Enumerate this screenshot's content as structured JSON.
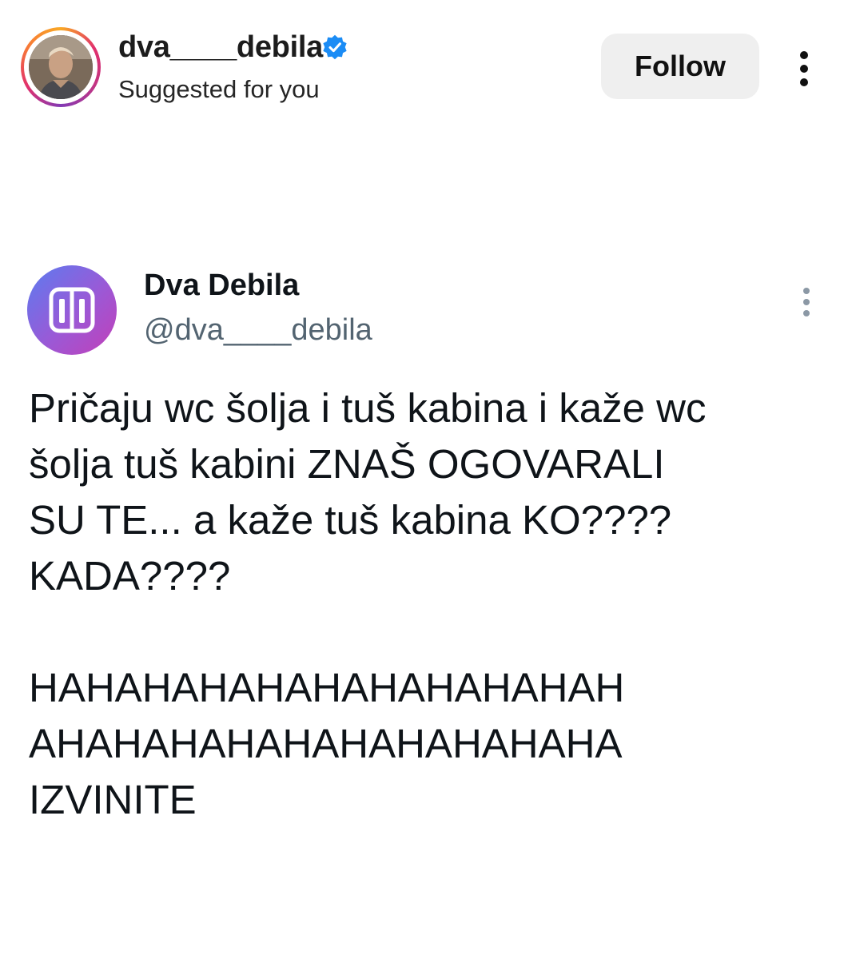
{
  "instagram": {
    "username": "dva____debila",
    "subtitle": "Suggested for you",
    "follow_label": "Follow",
    "verified": true,
    "verified_color": "#1b8cf5"
  },
  "tweet": {
    "display_name": "Dva Debila",
    "handle": "@dva____debila",
    "avatar_icon": "dva-debila-logo",
    "avatar_gradient": [
      "#5b7cf0",
      "#9b59d6",
      "#c23fb8"
    ],
    "lines": [
      "Pričaju wc šolja i tuš kabina i kaže wc",
      "šolja tuš kabini ZNAŠ OGOVARALI",
      "SU TE... a kaže tuš kabina KO????",
      "KADA????"
    ],
    "lines2": [
      "HAHAHAHAHAHAHAHAHAHAH",
      "AHAHAHAHAHAHAHAHAHAHA",
      "IZVINITE"
    ]
  }
}
